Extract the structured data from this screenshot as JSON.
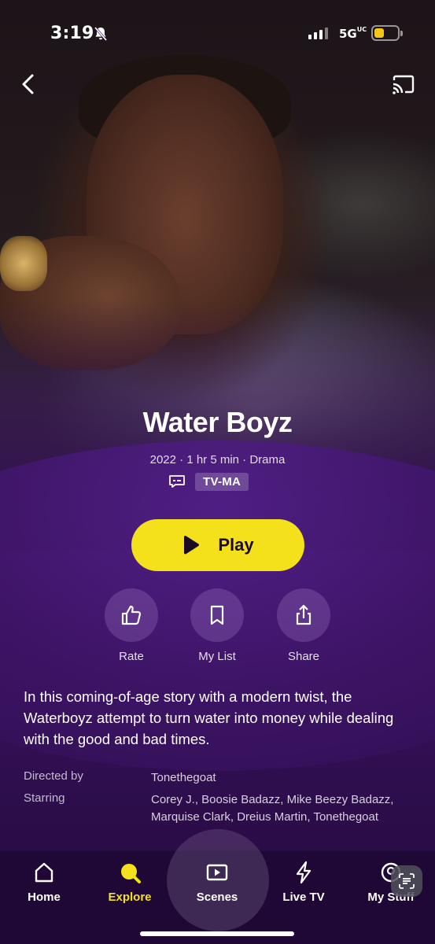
{
  "status_bar": {
    "time": "3:19",
    "network": "5G",
    "network_suffix": "UC",
    "battery_color": "#f5c518"
  },
  "header": {
    "back_icon": "chevron-left-icon",
    "cast_icon": "cast-icon"
  },
  "show": {
    "title": "Water Boyz",
    "meta": "2022 · 1 hr 5 min · Drama",
    "rating": "TV-MA",
    "cc_icon": "closed-captions-icon"
  },
  "play": {
    "label": "Play",
    "color": "#f4e11c"
  },
  "actions": [
    {
      "label": "Rate",
      "icon": "thumbs-up-icon"
    },
    {
      "label": "My List",
      "icon": "bookmark-icon"
    },
    {
      "label": "Share",
      "icon": "share-icon"
    }
  ],
  "description": "In this coming-of-age story with a modern twist, the Waterboyz attempt to turn water into money while dealing with the good and bad times.",
  "credits": {
    "directed_by_label": "Directed by",
    "directed_by": "Tonethegoat",
    "starring_label": "Starring",
    "starring": "Corey J., Boosie Badazz, Mike Beezy Badazz, Marquise Clark, Dreius Martin, Tonethegoat"
  },
  "tabs": [
    {
      "label": "Home",
      "icon": "home-icon",
      "active": false
    },
    {
      "label": "Explore",
      "icon": "search-icon",
      "active": true
    },
    {
      "label": "Scenes",
      "icon": "play-square-icon",
      "active": false
    },
    {
      "label": "Live TV",
      "icon": "lightning-icon",
      "active": false
    },
    {
      "label": "My Stuff",
      "icon": "my-stuff-icon",
      "active": false
    }
  ],
  "accent_color": "#f4e11c"
}
